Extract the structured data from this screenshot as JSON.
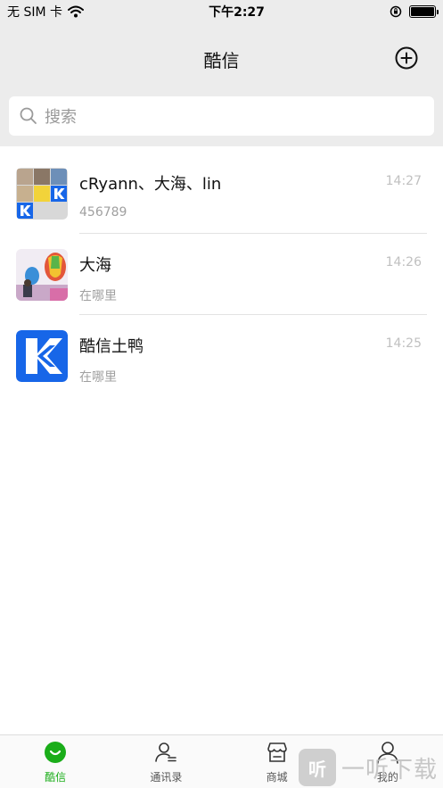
{
  "status_bar": {
    "carrier": "无 SIM 卡",
    "time": "下午2:27"
  },
  "header": {
    "title": "酷信"
  },
  "search": {
    "placeholder": "搜索"
  },
  "chats": [
    {
      "name": "cRyann、大海、lin",
      "preview": "456789",
      "time": "14:27",
      "avatar": "group-collage-avatar"
    },
    {
      "name": "大海",
      "preview": "在哪里",
      "time": "14:26",
      "avatar": "balloon-photo-avatar"
    },
    {
      "name": "酷信土鸭",
      "preview": "在哪里",
      "time": "14:25",
      "avatar": "k-logo-avatar"
    }
  ],
  "tabs": [
    {
      "label": "酷信",
      "icon": "chat-bubble-icon",
      "active": true
    },
    {
      "label": "通讯录",
      "icon": "contacts-icon",
      "active": false
    },
    {
      "label": "商城",
      "icon": "store-icon",
      "active": false
    },
    {
      "label": "我的",
      "icon": "profile-icon",
      "active": false
    }
  ],
  "watermark": {
    "icon_text": "听",
    "text": "一听下载"
  },
  "colors": {
    "accent": "#1aad19",
    "header_bg": "#ececec",
    "brand_blue": "#1766e8"
  }
}
